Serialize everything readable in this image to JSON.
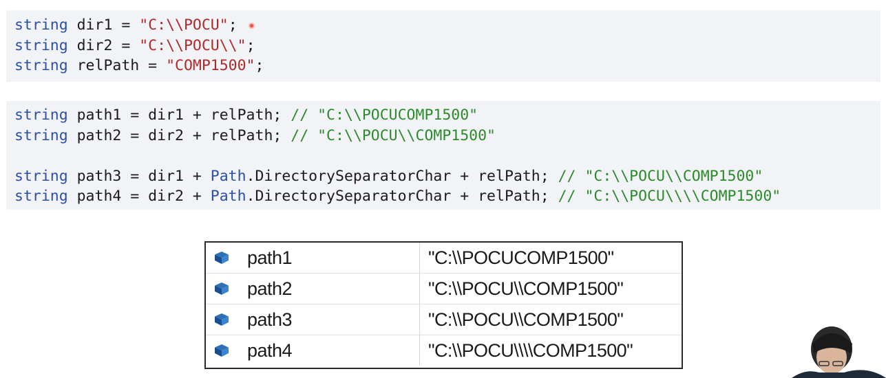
{
  "code": {
    "block1": [
      [
        {
          "t": "string",
          "c": "kw"
        },
        {
          "t": " dir1 = ",
          "c": ""
        },
        {
          "t": "\"C:\\\\POCU\"",
          "c": "str"
        },
        {
          "t": ";",
          "c": ""
        }
      ],
      [
        {
          "t": "string",
          "c": "kw"
        },
        {
          "t": " dir2 = ",
          "c": ""
        },
        {
          "t": "\"C:\\\\POCU\\\\\"",
          "c": "str"
        },
        {
          "t": ";",
          "c": ""
        }
      ],
      [
        {
          "t": "string",
          "c": "kw"
        },
        {
          "t": " relPath = ",
          "c": ""
        },
        {
          "t": "\"COMP1500\"",
          "c": "str"
        },
        {
          "t": ";",
          "c": ""
        }
      ]
    ],
    "block2": [
      [
        {
          "t": "string",
          "c": "kw"
        },
        {
          "t": " path1 = dir1 + relPath; ",
          "c": ""
        },
        {
          "t": "// \"C:\\\\POCUCOMP1500\"",
          "c": "cmt"
        }
      ],
      [
        {
          "t": "string",
          "c": "kw"
        },
        {
          "t": " path2 = dir2 + relPath; ",
          "c": ""
        },
        {
          "t": "// \"C:\\\\POCU\\\\COMP1500\"",
          "c": "cmt"
        }
      ],
      [],
      [
        {
          "t": "string",
          "c": "kw"
        },
        {
          "t": " path3 = dir1 + ",
          "c": ""
        },
        {
          "t": "Path",
          "c": "type"
        },
        {
          "t": ".DirectorySeparatorChar + relPath; ",
          "c": ""
        },
        {
          "t": "// \"C:\\\\POCU\\\\COMP1500\"",
          "c": "cmt"
        }
      ],
      [
        {
          "t": "string",
          "c": "kw"
        },
        {
          "t": " path4 = dir2 + ",
          "c": ""
        },
        {
          "t": "Path",
          "c": "type"
        },
        {
          "t": ".DirectorySeparatorChar + relPath; ",
          "c": ""
        },
        {
          "t": "// \"C:\\\\POCU\\\\\\\\COMP1500\"",
          "c": "cmt"
        }
      ]
    ]
  },
  "watch": {
    "rows": [
      {
        "name": "path1",
        "value": "\"C:\\\\POCUCOMP1500\""
      },
      {
        "name": "path2",
        "value": "\"C:\\\\POCU\\\\COMP1500\""
      },
      {
        "name": "path3",
        "value": "\"C:\\\\POCU\\\\COMP1500\""
      },
      {
        "name": "path4",
        "value": "\"C:\\\\POCU\\\\\\\\COMP1500\""
      }
    ],
    "icon": "variable-cube-icon"
  },
  "colors": {
    "keyword": "#2b4fa8",
    "string": "#b02a2a",
    "comment": "#2c8a2c",
    "code_bg": "#f2f3f6"
  }
}
